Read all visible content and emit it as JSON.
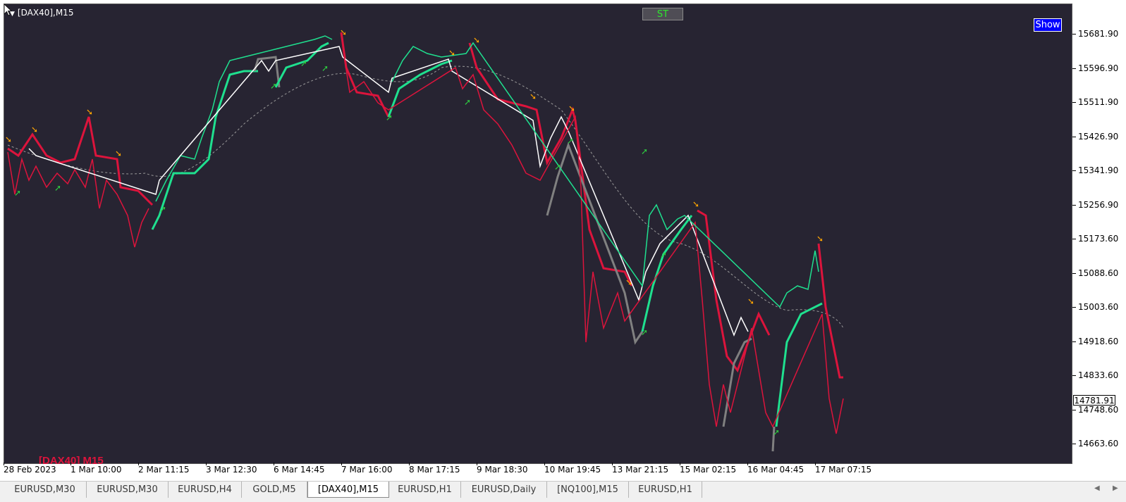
{
  "chart": {
    "title": "[DAX40],M15",
    "st_button": "ST",
    "show_button": "Show",
    "bottom_label": "[DAX40] M15",
    "current_price": "14781.91"
  },
  "price_axis": [
    "15681.90",
    "15596.90",
    "15511.90",
    "15426.90",
    "15341.90",
    "15256.90",
    "15173.60",
    "15088.60",
    "15003.60",
    "14918.60",
    "14833.60",
    "14748.60",
    "14663.60"
  ],
  "time_axis": [
    "28 Feb 2023",
    "1 Mar 10:00",
    "2 Mar 11:15",
    "3 Mar 12:30",
    "6 Mar 14:45",
    "7 Mar 16:00",
    "8 Mar 17:15",
    "9 Mar 18:30",
    "10 Mar 19:45",
    "13 Mar 21:15",
    "15 Mar 02:15",
    "16 Mar 04:45",
    "17 Mar 07:15"
  ],
  "tabs": [
    {
      "label": "EURUSD,M30",
      "active": false
    },
    {
      "label": "EURUSD,M30",
      "active": false
    },
    {
      "label": "EURUSD,H4",
      "active": false
    },
    {
      "label": "GOLD,M5",
      "active": false
    },
    {
      "label": "[DAX40],M15",
      "active": true
    },
    {
      "label": "EURUSD,H1",
      "active": false
    },
    {
      "label": "EURUSD,Daily",
      "active": false
    },
    {
      "label": "[NQ100],M15",
      "active": false
    },
    {
      "label": "EURUSD,H1",
      "active": false
    }
  ],
  "colors": {
    "background": "#272432",
    "up": "#1fe08f",
    "down": "#dc143c",
    "neutral": "#ffffff",
    "trail_gray": "#808080",
    "arrow_up": "#2ecc40",
    "arrow_down": "#ffa500"
  }
}
